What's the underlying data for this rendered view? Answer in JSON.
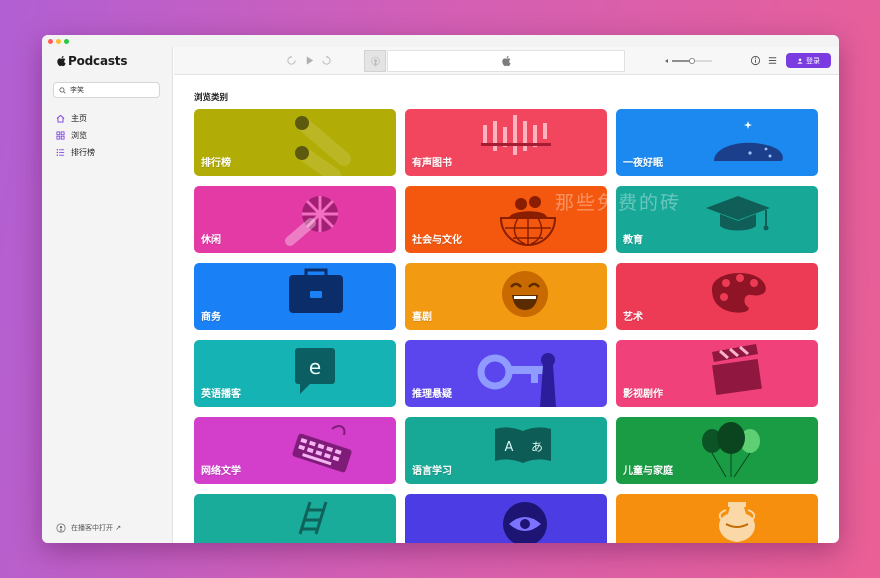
{
  "app": {
    "name": "Podcasts"
  },
  "sidebar": {
    "search_text": "李笑",
    "items": [
      {
        "label": "主页",
        "icon": "house-icon"
      },
      {
        "label": "浏览",
        "icon": "grid-icon"
      },
      {
        "label": "排行榜",
        "icon": "list-icon"
      }
    ],
    "open_in_label": "在播客中打开 ↗"
  },
  "toolbar": {
    "login_label": "登录"
  },
  "main": {
    "section_title": "浏览类别",
    "categories": [
      {
        "label": "排行榜",
        "color": "#b2ad06"
      },
      {
        "label": "有声图书",
        "color": "#f2465e"
      },
      {
        "label": "一夜好眠",
        "color": "#1c89f0"
      },
      {
        "label": "休闲",
        "color": "#e43aa6"
      },
      {
        "label": "社会与文化",
        "color": "#f4580e"
      },
      {
        "label": "教育",
        "color": "#17a898"
      },
      {
        "label": "商务",
        "color": "#1a80f5"
      },
      {
        "label": "喜剧",
        "color": "#f39a13"
      },
      {
        "label": "艺术",
        "color": "#ee3b55"
      },
      {
        "label": "英语播客",
        "color": "#15b3b3"
      },
      {
        "label": "推理悬疑",
        "color": "#5b46ee"
      },
      {
        "label": "影视剧作",
        "color": "#f0417a"
      },
      {
        "label": "网络文学",
        "color": "#d33ecb"
      },
      {
        "label": "语言学习",
        "color": "#18a896"
      },
      {
        "label": "儿童与家庭",
        "color": "#1a9c44"
      },
      {
        "label": "",
        "color": "#19ac9a"
      },
      {
        "label": "",
        "color": "#4b3ce4"
      },
      {
        "label": "",
        "color": "#f58f0d"
      }
    ]
  },
  "watermark": "那些免费的砖",
  "colors": {
    "accent": "#7a3ce0"
  }
}
